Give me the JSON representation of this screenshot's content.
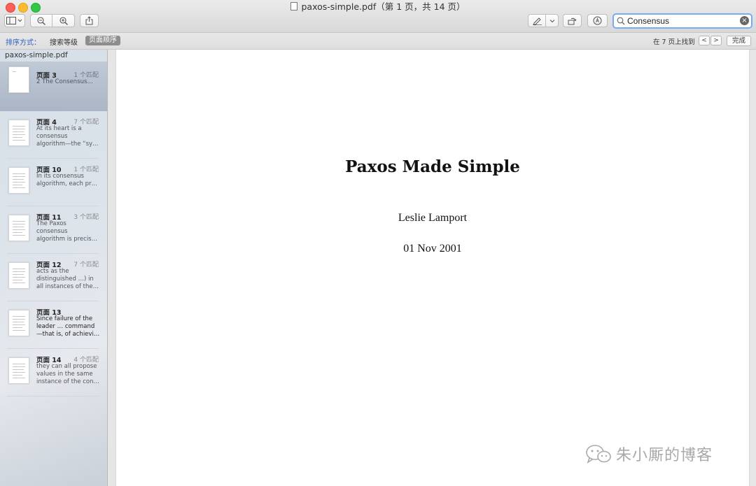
{
  "window": {
    "title": "paxos-simple.pdf（第 1 页，共 14 页）"
  },
  "toolbar": {
    "sidebar_icon": "sidebar-icon",
    "zoom_out_icon": "zoom-out-icon",
    "zoom_in_icon": "zoom-in-icon",
    "share_icon": "share-icon",
    "markup_icon": "pen-icon",
    "rotate_icon": "rotate-icon",
    "annotate_icon": "annotate-icon",
    "search": {
      "value": "Consensus",
      "icon": "search-icon"
    }
  },
  "findbar": {
    "sort_label": "排序方式：",
    "sort_relevance": "搜索等级",
    "sort_page_order": "页面顺序",
    "found_text": "在 7 页上找到",
    "prev": "<",
    "next": ">",
    "done": "完成"
  },
  "sidebar": {
    "title": "paxos-simple.pdf",
    "results": [
      {
        "page": "页面 3",
        "matches": "1 个匹配",
        "snippet": "2 The Consensus…"
      },
      {
        "page": "页面 4",
        "matches": "7 个匹配",
        "snippet": "At its heart is a\nconsensus\nalgorithm—the “sy…"
      },
      {
        "page": "页面 10",
        "matches": "1 个匹配",
        "snippet": "In its consensus\nalgorithm, each pr…"
      },
      {
        "page": "页面 11",
        "matches": "3 个匹配",
        "snippet": "The Paxos\nconsensus\nalgorithm is precis…"
      },
      {
        "page": "页面 12",
        "matches": "7 个匹配",
        "snippet": "acts as the\ndistinguished …) in\nall instances of the…"
      },
      {
        "page": "页面 13",
        "matches": "",
        "snippet": "Since failure of the\nleader … command\n—that is, of achievi…"
      },
      {
        "page": "页面 14",
        "matches": "4 个匹配",
        "snippet": "they can all propose\nvalues in the same\ninstance of the con…"
      }
    ]
  },
  "document": {
    "title": "Paxos Made Simple",
    "author": "Leslie Lamport",
    "date": "01 Nov 2001"
  },
  "watermark": {
    "text": "朱小厮的博客",
    "icon": "wechat-icon"
  }
}
